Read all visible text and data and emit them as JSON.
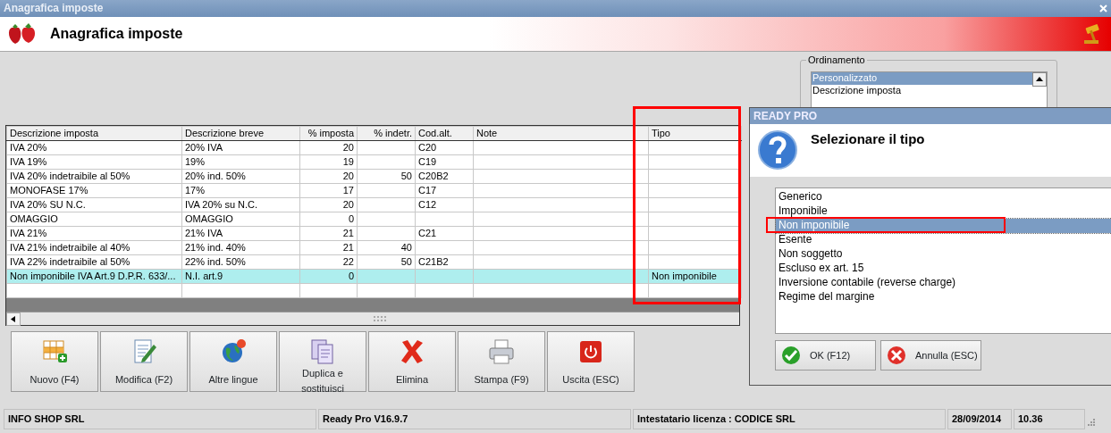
{
  "window": {
    "title": "Anagrafica imposte"
  },
  "header": {
    "title": "Anagrafica imposte"
  },
  "ordering": {
    "label": "Ordinamento",
    "items": [
      {
        "label": "Personalizzato",
        "selected": true
      },
      {
        "label": "Descrizione imposta",
        "selected": false
      }
    ]
  },
  "table": {
    "columns": [
      {
        "label": "Descrizione imposta",
        "kind": "text"
      },
      {
        "label": "Descrizione breve",
        "kind": "text"
      },
      {
        "label": "% imposta",
        "kind": "number"
      },
      {
        "label": "% indetr.",
        "kind": "number"
      },
      {
        "label": "Cod.alt.",
        "kind": "text"
      },
      {
        "label": "Note",
        "kind": "text"
      },
      {
        "kind": "spacer"
      },
      {
        "label": "Tipo",
        "kind": "text"
      }
    ],
    "rows": [
      {
        "selected": false,
        "cells": [
          "IVA 20%",
          "20% IVA",
          "20",
          null,
          "C20",
          null,
          null,
          null
        ]
      },
      {
        "selected": false,
        "cells": [
          "IVA 19%",
          "19%",
          "19",
          null,
          "C19",
          null,
          null,
          null
        ]
      },
      {
        "selected": false,
        "cells": [
          "IVA 20% indetraibile al 50%",
          "20% ind. 50%",
          "20",
          "50",
          "C20B2",
          null,
          null,
          null
        ]
      },
      {
        "selected": false,
        "cells": [
          "MONOFASE 17%",
          "17%",
          "17",
          null,
          "C17",
          null,
          null,
          null
        ]
      },
      {
        "selected": false,
        "cells": [
          "IVA 20% SU N.C.",
          "IVA 20% su N.C.",
          "20",
          null,
          "C12",
          null,
          null,
          null
        ]
      },
      {
        "selected": false,
        "cells": [
          "OMAGGIO",
          "OMAGGIO",
          "0",
          null,
          null,
          null,
          null,
          null
        ]
      },
      {
        "selected": false,
        "cells": [
          "IVA 21%",
          "21% IVA",
          "21",
          null,
          "C21",
          null,
          null,
          null
        ]
      },
      {
        "selected": false,
        "cells": [
          "IVA 21% indetraibile al 40%",
          "21% ind. 40%",
          "21",
          "40",
          null,
          null,
          null,
          null
        ]
      },
      {
        "selected": false,
        "cells": [
          "IVA 22% indetraibile al 50%",
          "22% ind. 50%",
          "22",
          "50",
          "C21B2",
          null,
          null,
          null
        ]
      },
      {
        "selected": true,
        "cells": [
          "Non imponibile IVA Art.9 D.P.R. 633/...",
          "N.I. art.9",
          "0",
          null,
          null,
          null,
          null,
          "Non imponibile"
        ]
      }
    ]
  },
  "toolbar": [
    {
      "label": "Nuovo (F4)",
      "kind": "new"
    },
    {
      "label": "Modifica (F2)",
      "kind": "edit"
    },
    {
      "label": "Altre lingue",
      "kind": "globe"
    },
    {
      "label": "Duplica e sostituisci",
      "kind": "duplicate"
    },
    {
      "label": "Elimina",
      "kind": "delete"
    },
    {
      "label": "Stampa (F9)",
      "kind": "print"
    },
    {
      "label": "Uscita (ESC)",
      "kind": "exit"
    }
  ],
  "status_bar": [
    "INFO SHOP SRL",
    "Ready Pro V16.9.7",
    "Intestatario licenza : CODICE SRL",
    "28/09/2014",
    "10.36"
  ],
  "dialog": {
    "title": "READY PRO",
    "prompt": "Selezionare il tipo",
    "options": [
      {
        "label": "Generico",
        "selected": false
      },
      {
        "label": "Imponibile",
        "selected": false
      },
      {
        "label": "Non imponibile",
        "selected": true
      },
      {
        "label": "Esente",
        "selected": false
      },
      {
        "label": "Non soggetto",
        "selected": false
      },
      {
        "label": "Escluso ex art. 15",
        "selected": false
      },
      {
        "label": "Inversione contabile (reverse charge)",
        "selected": false
      },
      {
        "label": "Regime del margine",
        "selected": false
      }
    ],
    "buttons": [
      {
        "label": "OK (F12)",
        "kind": "ok"
      },
      {
        "label": "Annulla (ESC)",
        "kind": "cancel"
      }
    ]
  }
}
